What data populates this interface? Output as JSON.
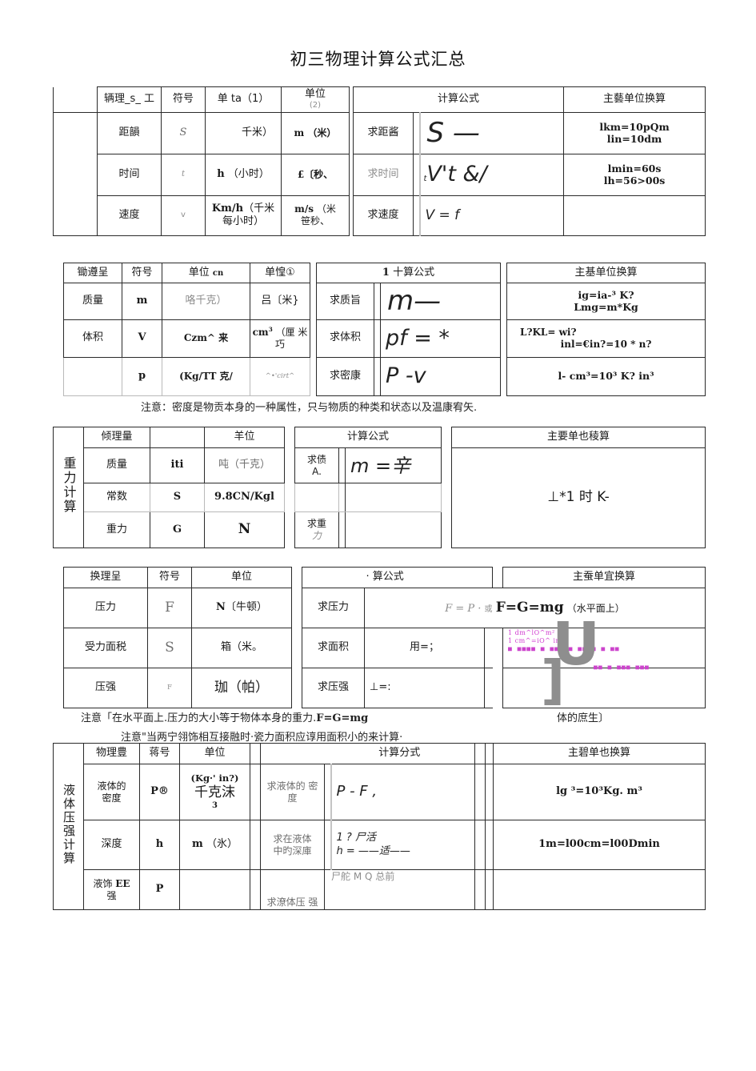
{
  "document": {
    "title": "初三物理计算公式汇总"
  },
  "tables": [
    {
      "id": "speed",
      "headers": {
        "quantity": "辆理_s_ 工",
        "symbol": "符号",
        "unit1": "单 ta（1）",
        "unit2_line1": "单位",
        "unit2_line2": "(2)",
        "formula": "计算公式",
        "conversion": "主藝单位换算"
      },
      "rows": [
        {
          "quantity": "距韻",
          "symbol": "S",
          "unit1": "千米）",
          "unit2": "m （米）",
          "task": "求距酱",
          "formula": "S —",
          "conversion_lines": [
            "lkm=10pQm",
            "lin=10dm"
          ]
        },
        {
          "quantity": "时间",
          "symbol": "t",
          "unit1": "h （小时）",
          "unit2": "£〔秒、",
          "task": "求时间",
          "formula": "V't &/",
          "formula_prefix": "t",
          "conversion_lines": [
            "lmin=60s",
            "lh=56>00s"
          ]
        },
        {
          "quantity": "速度",
          "symbol": "v",
          "unit1_line1": "Km/h（千米",
          "unit1_line2": "每小时）",
          "unit2_line1": "m/s （米",
          "unit2_line2": "笹秒、",
          "task": "求速度",
          "formula": "V = f",
          "conversion_lines": []
        }
      ]
    },
    {
      "id": "density",
      "headers": {
        "quantity": "锄遵呈",
        "symbol": "符号",
        "unit1": "单位 cn",
        "unit2": "单惶①",
        "formula": "1 十算公式",
        "conversion": "主基单位换算"
      },
      "rows": [
        {
          "quantity": "质量",
          "symbol": "m",
          "unit1": "咯千克）",
          "unit2": "吕〔米}",
          "task": "求质旨",
          "formula": "m—",
          "conversion_lines": [
            "ig=ia-³ K?",
            "Lmg=m*Kg"
          ]
        },
        {
          "quantity": "体积",
          "symbol": "V",
          "unit1": "Czm^ 来",
          "unit2_line1": "cm³ （厘 米",
          "unit2_line2": "巧",
          "task": "求体积",
          "formula": "pf = *",
          "conversion_lines": [
            "L?KL=                wi?",
            "inl=€in?=10 * n?"
          ]
        },
        {
          "quantity": "",
          "symbol": "p",
          "unit1": "(Kg/TT 克/",
          "unit2": "^•'cirt^",
          "task": "求密康",
          "formula": "P -v",
          "conversion_lines": [
            "l- cm³=10³ K? in³"
          ]
        }
      ]
    },
    {
      "id": "gravity",
      "side_label": "重力计算",
      "headers": {
        "quantity": "倾理量",
        "symbol": "",
        "unit": "羊位",
        "formula": "计算公式",
        "conversion": "主要单也稜算"
      },
      "rows": [
        {
          "quantity": "质量",
          "symbol": "iti",
          "unit": "吨（千克）",
          "task_line1": "求债",
          "task_line2": "A.",
          "formula": "m =辛"
        },
        {
          "quantity": "常数",
          "symbol": "S",
          "unit": "9.8CN/Kgl",
          "task": "",
          "formula": ""
        },
        {
          "quantity": "重力",
          "symbol": "G",
          "unit": "N",
          "task_line1": "求重",
          "task_line2": "力",
          "formula": ""
        }
      ],
      "conversion_text": "⊥*1 时 K-"
    },
    {
      "id": "pressure",
      "headers": {
        "quantity": "换理呈",
        "symbol": "符号",
        "unit": "单位",
        "formula": "· 算公式",
        "conversion": "主蚕单宜换算"
      },
      "rows": [
        {
          "quantity": "压力",
          "symbol": "F",
          "unit": "N〔牛顿）",
          "task": "求压力",
          "formula_italic": "F = P ·",
          "formula_mid": "或",
          "formula_bold": "F=G=mg",
          "formula_tail": "（水平面上）",
          "conversion_lines": []
        },
        {
          "quantity": "受力面税",
          "symbol": "S",
          "unit": "箱（米。",
          "task": "求面积",
          "formula": "用=；",
          "conversion_lines": [
            "1 dm^lO^m²",
            "1 cm^=iO^ in®"
          ]
        },
        {
          "quantity": "压强",
          "symbol": "F",
          "unit": "珈（帕）",
          "task": "求压强",
          "formula": "⊥=:",
          "conversion_lines": []
        }
      ]
    },
    {
      "id": "liquid_pressure",
      "side_label": "液体压强计算",
      "headers": {
        "quantity": "物理豊",
        "symbol": "蒋号",
        "unit": "单位",
        "formula": "计算分式",
        "conversion": "主碧单也换算"
      },
      "rows": [
        {
          "quantity_line1": "液体的",
          "quantity_line2": "密度",
          "symbol": "P®",
          "unit_line1": "(Kg·' in?)",
          "unit_line2": "千克沫",
          "unit_line3": "3",
          "task_line1": "求液体的 密",
          "task_line2": "度",
          "formula": "P          -        F  ,",
          "conversion": "lg     ³=10³Kg. m³"
        },
        {
          "quantity": "深度",
          "symbol": "h",
          "unit": "m （氷）",
          "task_line1": "求在液体",
          "task_line2": "中旳深庫",
          "formula_line1": "1 ?            尸活",
          "formula_line2": "h =     ——适——",
          "conversion": "1m=l00cm=l00Dmin"
        },
        {
          "quantity_line1": "液饰 EE",
          "quantity_line2": "强",
          "symbol": "P",
          "unit": "",
          "task": "求潦体压 强",
          "formula": "尸舵 M Q 总前",
          "conversion": ""
        }
      ]
    }
  ],
  "notes": [
    {
      "id": "density-note",
      "text": "注意：密度是物贡本身的一种属性，只与物质的种类和状态以及温康宥矢."
    },
    {
      "id": "pressure-note-1",
      "text_plain": "注意「在水平面上.压力的大小等于物体本身的重力.",
      "text_bold": "F=G=mg",
      "text_tail": "体的庶生〕"
    },
    {
      "id": "pressure-note-2",
      "text": "注意\"当两宁翎饰相互接融时·瓷力面积应谆用面积小的来计算·"
    }
  ],
  "artifacts": {
    "u_glyph": "U",
    "bar_glyph": "]",
    "blocky_line1": "■ ■■■■ ■ ■■■■■ ■■>■ ■   ■■",
    "blocky_line2": "■■ ■ ■■■ ■■■"
  }
}
